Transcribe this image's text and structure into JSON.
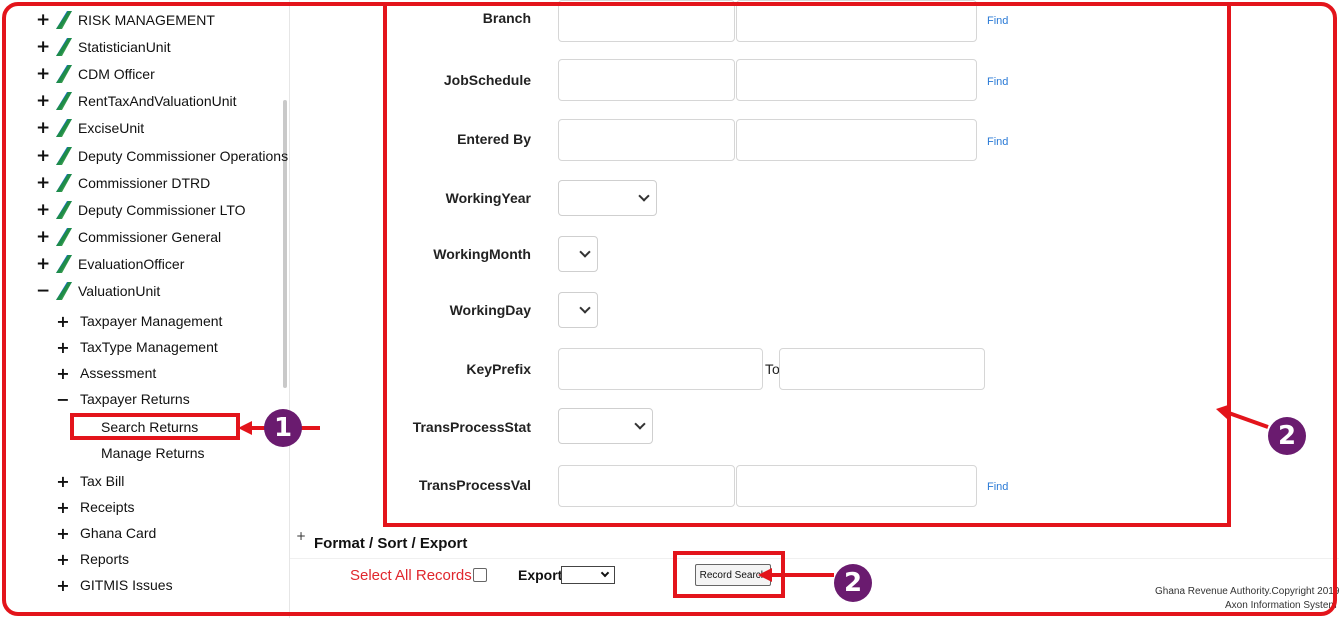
{
  "sidebar": {
    "roots": [
      {
        "toggle": "+",
        "label": "RISK MANAGEMENT"
      },
      {
        "toggle": "+",
        "label": "StatisticianUnit"
      },
      {
        "toggle": "+",
        "label": "CDM Officer"
      },
      {
        "toggle": "+",
        "label": "RentTaxAndValuationUnit"
      },
      {
        "toggle": "+",
        "label": "ExciseUnit"
      },
      {
        "toggle": "+",
        "label": "Deputy Commissioner Operations"
      },
      {
        "toggle": "+",
        "label": "Commissioner DTRD"
      },
      {
        "toggle": "+",
        "label": "Deputy Commissioner LTO"
      },
      {
        "toggle": "+",
        "label": "Commissioner General"
      },
      {
        "toggle": "+",
        "label": "EvaluationOfficer"
      },
      {
        "toggle": "−",
        "label": "ValuationUnit"
      }
    ],
    "children": [
      {
        "toggle": "+",
        "label": "Taxpayer Management"
      },
      {
        "toggle": "+",
        "label": "TaxType Management"
      },
      {
        "toggle": "+",
        "label": "Assessment"
      },
      {
        "toggle": "−",
        "label": "Taxpayer Returns"
      },
      {
        "toggle": "+",
        "label": "Tax Bill"
      },
      {
        "toggle": "+",
        "label": "Receipts"
      },
      {
        "toggle": "+",
        "label": "Ghana Card"
      },
      {
        "toggle": "+",
        "label": "Reports"
      },
      {
        "toggle": "+",
        "label": "GITMIS Issues"
      }
    ],
    "leaves": [
      {
        "label": "Search Returns"
      },
      {
        "label": "Manage Returns"
      }
    ]
  },
  "form": {
    "branch": {
      "label": "Branch",
      "find": "Find"
    },
    "job_schedule": {
      "label": "JobSchedule",
      "find": "Find"
    },
    "entered_by": {
      "label": "Entered By",
      "find": "Find"
    },
    "working_year": {
      "label": "WorkingYear"
    },
    "working_month": {
      "label": "WorkingMonth"
    },
    "working_day": {
      "label": "WorkingDay"
    },
    "key_prefix": {
      "label": "KeyPrefix",
      "to": "To"
    },
    "trans_process_stat": {
      "label": "TransProcessStat"
    },
    "trans_process_val": {
      "label": "TransProcessVal",
      "find": "Find"
    }
  },
  "bottom": {
    "format_toggle": "+",
    "format_title": "Format / Sort / Export",
    "select_all": "Select All Records",
    "export_label": "Export",
    "record_search": "Record Search"
  },
  "footer": {
    "copyright": "Ghana Revenue Authority.Copyright 2019",
    "system": "Axon Information System"
  },
  "annotations": {
    "badge_1": "1",
    "badge_2a": "2",
    "badge_2b": "2",
    "accent_color": "#e3141b",
    "badge_color": "#6a1b6f"
  }
}
